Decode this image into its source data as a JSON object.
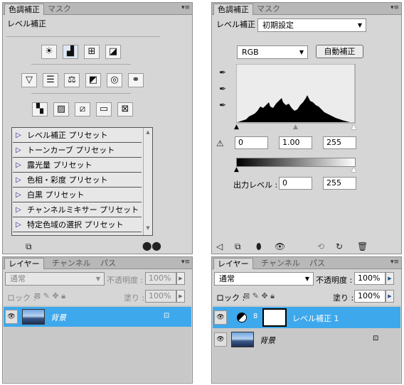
{
  "left_adjust": {
    "tabs": [
      "色調補正",
      "マスク"
    ],
    "title": "レベル補正",
    "presets": [
      "レベル補正 プリセット",
      "トーンカーブ プリセット",
      "露光量 プリセット",
      "色相・彩度 プリセット",
      "白黒 プリセット",
      "チャンネルミキサー プリセット",
      "特定色域の選択 プリセット"
    ]
  },
  "left_layers": {
    "tabs": [
      "レイヤー",
      "チャンネル",
      "パス"
    ],
    "blend_mode": "通常",
    "opacity_label": "不透明度 :",
    "opacity": "100%",
    "lock_label": "ロック :",
    "fill_label": "塗り :",
    "fill": "100%",
    "layers": [
      {
        "name": "背景"
      }
    ]
  },
  "right_adjust": {
    "tabs": [
      "色調補正",
      "マスク"
    ],
    "title": "レベル補正",
    "preset_value": "初期設定",
    "channel": "RGB",
    "auto_button": "自動補正",
    "input_levels": [
      "0",
      "1.00",
      "255"
    ],
    "output_label": "出力レベル :",
    "output_levels": [
      "0",
      "255"
    ]
  },
  "right_layers": {
    "tabs": [
      "レイヤー",
      "チャンネル",
      "パス"
    ],
    "blend_mode": "通常",
    "opacity_label": "不透明度 :",
    "opacity": "100%",
    "lock_label": "ロック :",
    "fill_label": "塗り :",
    "fill": "100%",
    "layers": [
      {
        "name": "レベル補正 1"
      },
      {
        "name": "背景"
      }
    ]
  },
  "colors": {
    "selected_layer": "#3ea8ec",
    "panel": "#d6d6d6"
  }
}
